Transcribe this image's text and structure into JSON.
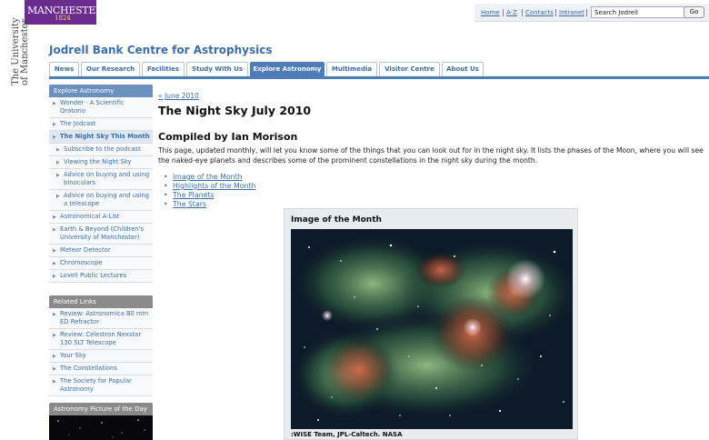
{
  "header": {
    "logo_name": "MANCHESTER",
    "logo_year": "1824",
    "vertical_line1": "The University",
    "vertical_line2": "of Manchester",
    "toplinks": [
      "Home",
      "A-Z",
      "Contacts",
      "Intranet"
    ],
    "search_value": "Search Jodrell",
    "go_label": "Go"
  },
  "site_title": "Jodrell Bank Centre for Astrophysics",
  "nav": {
    "tabs": [
      "News",
      "Our Research",
      "Facilities",
      "Study With Us",
      "Explore Astronomy",
      "Multimedia",
      "Visitor Centre",
      "About Us"
    ],
    "active_index": 4
  },
  "sidebar": {
    "explore": {
      "heading": "Explore Astronomy",
      "items": [
        "Wonder - A Scientific Oratorio",
        "The Jodcast",
        "The Night Sky This Month",
        "Subscribe to the podcast",
        "Viewing the Night Sky",
        "Advice on buying and using binoculars",
        "Advice on buying and using a telescope",
        "Astronomical A-List",
        "Earth & Beyond (Children's University of Manchester)",
        "Meteor Detector",
        "Chromoscope",
        "Lovell Public Lectures"
      ]
    },
    "related": {
      "heading": "Related Links",
      "items": [
        "Review: Astronomica 80 mm ED Refractor",
        "Review: Celestron Nexstar 130 SLT Telescope",
        "Your Sky",
        "The Constellations",
        "The Society for Popular Astronomy"
      ]
    },
    "apod": {
      "heading": "Astronomy Picture of the Day"
    }
  },
  "main": {
    "breadcrumb": "« June 2010",
    "title": "The Night Sky July 2010",
    "author_heading": "Compiled by Ian Morison",
    "intro": "This page, updated monthly, will let you know some of the things that you can look out for in the night sky. It lists the phases of the Moon, where you will see the naked-eye planets and describes some of the prominent constellations in the night sky during the month.",
    "toc": [
      "Image of the Month",
      "Highlights of the Month",
      "The Planets",
      "The Stars"
    ]
  },
  "figure": {
    "title": "Image of the Month",
    "credit": ":WISE Team, JPL-Caltech. NASA"
  },
  "colors": {
    "brand_purple": "#6a2c8f",
    "link_blue": "#3b6ea8",
    "nav_blue": "#4d7cb6"
  }
}
